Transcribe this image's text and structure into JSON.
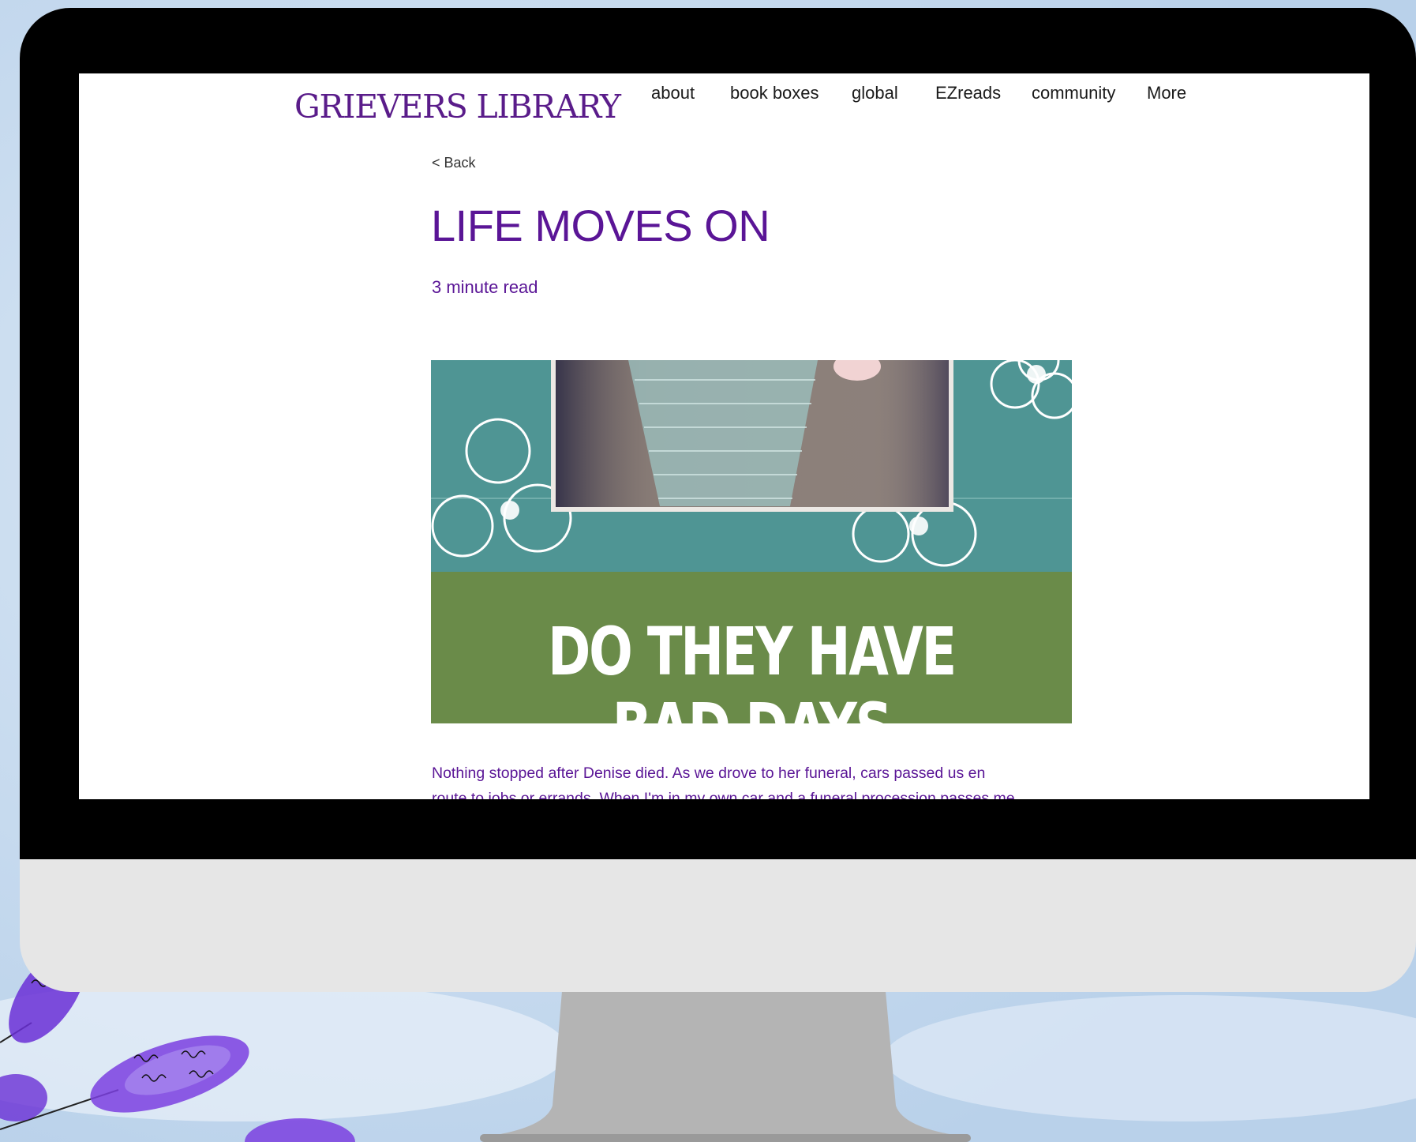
{
  "site": {
    "logo": "GRIEVERS LIBRARY",
    "nav": [
      "about",
      "book boxes",
      "global",
      "EZreads",
      "community",
      "More"
    ]
  },
  "article": {
    "back_label": "< Back",
    "title": "LIFE MOVES ON",
    "read_time": "3 minute read",
    "hero_headline_line1": "DO THEY HAVE",
    "hero_headline_line2": "BAD DAYS",
    "body_line1": "Nothing stopped after Denise died. As we drove to her funeral, cars passed us en",
    "body_line2": "route to jobs or errands. When I'm in my own car and a funeral procession passes me"
  },
  "colors": {
    "brand_purple": "#5a1596",
    "hero_teal": "#4f9594",
    "hero_green": "#6a8b49",
    "bezel": "#000000",
    "chin": "#e6e6e6",
    "stand": "#b4b4b4"
  }
}
